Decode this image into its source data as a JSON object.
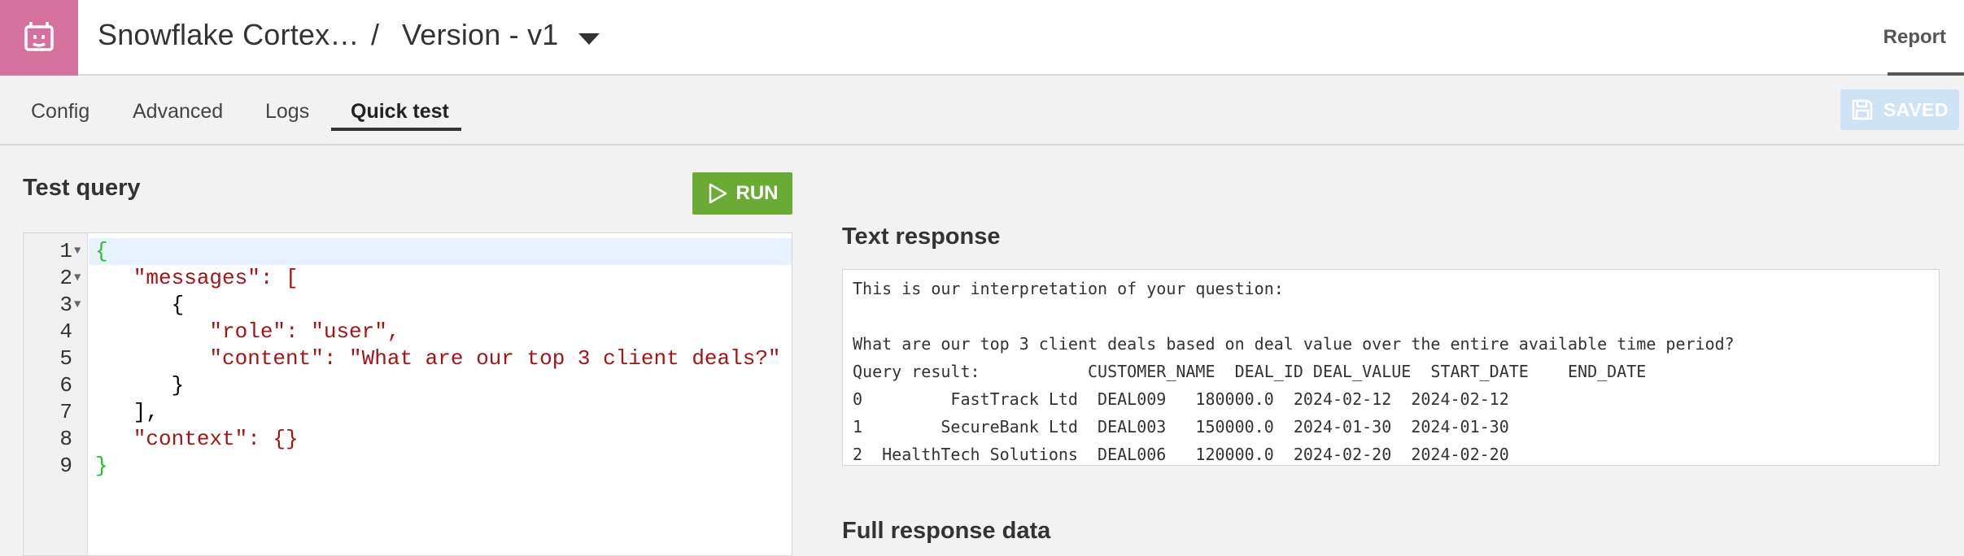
{
  "header": {
    "project_name": "Snowflake Cortex…",
    "separator": "/",
    "version_label": "Version - v1",
    "report_link": "Report"
  },
  "tabs": [
    {
      "label": "Config",
      "active": false
    },
    {
      "label": "Advanced",
      "active": false
    },
    {
      "label": "Logs",
      "active": false
    },
    {
      "label": "Quick test",
      "active": true
    }
  ],
  "toolbar": {
    "saved_label": "SAVED"
  },
  "test_query": {
    "title": "Test query",
    "run_label": "RUN",
    "line_numbers": [
      "1",
      "2",
      "3",
      "4",
      "5",
      "6",
      "7",
      "8",
      "9"
    ],
    "lines": [
      "{",
      "   \"messages\": [",
      "      {",
      "         \"role\": \"user\",",
      "         \"content\": \"What are our top 3 client deals?\"",
      "      }",
      "   ],",
      "   \"context\": {}",
      "}"
    ]
  },
  "text_response": {
    "title": "Text response",
    "lines": [
      "This is our interpretation of your question:",
      "",
      "What are our top 3 client deals based on deal value over the entire available time period?",
      "Query result:           CUSTOMER_NAME  DEAL_ID DEAL_VALUE  START_DATE    END_DATE",
      "0         FastTrack Ltd  DEAL009   180000.0  2024-02-12  2024-02-12",
      "1        SecureBank Ltd  DEAL003   150000.0  2024-01-30  2024-01-30",
      "2  HealthTech Solutions  DEAL006   120000.0  2024-02-20  2024-02-20"
    ]
  },
  "full_response": {
    "title": "Full response data"
  },
  "colors": {
    "brand_pink": "#d5719f",
    "run_green": "#6aab35",
    "saved_blue": "#cfe3f6",
    "json_string": "#a31515",
    "json_brace": "#21c41e"
  },
  "icons": [
    "robot-logo-icon",
    "chevron-down-icon",
    "save-icon",
    "play-icon"
  ]
}
